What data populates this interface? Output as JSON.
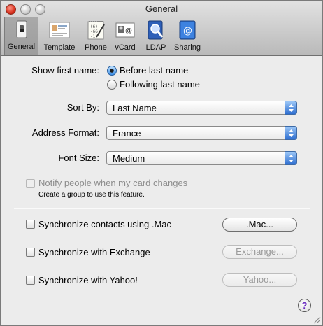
{
  "window": {
    "title": "General"
  },
  "toolbar": {
    "items": [
      {
        "label": "General",
        "icon": "general-switch-icon",
        "selected": true
      },
      {
        "label": "Template",
        "icon": "template-card-icon",
        "selected": false
      },
      {
        "label": "Phone",
        "icon": "phone-notepad-icon",
        "selected": false
      },
      {
        "label": "vCard",
        "icon": "vcard-icon",
        "selected": false
      },
      {
        "label": "LDAP",
        "icon": "ldap-directory-icon",
        "selected": false
      },
      {
        "label": "Sharing",
        "icon": "sharing-book-icon",
        "selected": false
      }
    ]
  },
  "show_first_name": {
    "label": "Show first name:",
    "options": [
      "Before last name",
      "Following last name"
    ],
    "selected": "Before last name"
  },
  "sort_by": {
    "label": "Sort By:",
    "value": "Last Name"
  },
  "address_format": {
    "label": "Address Format:",
    "value": "France"
  },
  "font_size": {
    "label": "Font Size:",
    "value": "Medium"
  },
  "notify": {
    "label": "Notify people when my card changes",
    "hint": "Create a group to use this feature.",
    "enabled": false
  },
  "sync": [
    {
      "label": "Synchronize contacts using .Mac",
      "button": ".Mac...",
      "button_enabled": true
    },
    {
      "label": "Synchronize with Exchange",
      "button": "Exchange...",
      "button_enabled": false
    },
    {
      "label": "Synchronize with Yahoo!",
      "button": "Yahoo...",
      "button_enabled": false
    }
  ],
  "help": {
    "glyph": "?"
  },
  "colors": {
    "accent": "#3d8fe6",
    "help": "#6a2bc0"
  }
}
